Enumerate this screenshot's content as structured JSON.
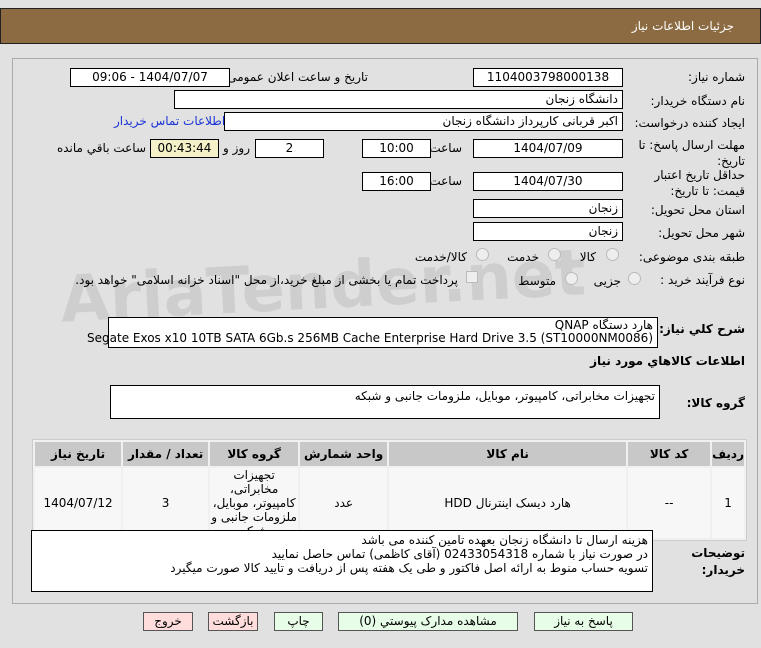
{
  "header": {
    "title": "جزئیات اطلاعات نیاز"
  },
  "watermark": "AriaTender.net",
  "form": {
    "need_number_label": "شماره نیاز:",
    "need_number": "1104003798000138",
    "announce_label": "تاریخ و ساعت اعلان عمومی:",
    "announce_value": "1404/07/07 - 09:06",
    "buyer_org_label": "نام دستگاه خریدار:",
    "buyer_org": "دانشگاه زنجان",
    "creator_label": "ایجاد کننده درخواست:",
    "creator": "اکبر قربانی کارپرداز دانشگاه زنجان",
    "contact_link": "اطلاعات تماس خریدار",
    "deadline_label": "مهلت ارسال پاسخ: تا تاریخ:",
    "deadline_date": "1404/07/09",
    "time_label": "ساعت",
    "deadline_time": "10:00",
    "days": "2",
    "days_label": "روز و",
    "remaining": "00:43:44",
    "remaining_label": "ساعت باقي مانده",
    "validity_label": "حداقل تاریخ اعتبار قیمت: تا تاریخ:",
    "validity_date": "1404/07/30",
    "validity_time": "16:00",
    "province_label": "استان محل تحویل:",
    "province": "زنجان",
    "city_label": "شهر محل تحویل:",
    "city": "زنجان",
    "category_label": "طبقه بندی موضوعی:",
    "category_options": [
      "کالا",
      "خدمت",
      "کالا/خدمت"
    ],
    "process_label": "نوع فرآیند خرید :",
    "process_options": [
      "جزیی",
      "متوسط"
    ],
    "payment_note": "پرداخت تمام یا بخشی از مبلغ خرید،از محل \"اسناد خزانه اسلامی\" خواهد بود.",
    "description_label": "شرح کلي نياز:",
    "description_line1": "هارد دستگاه QNAP",
    "description_line2": "Segate Exos x10 10TB SATA 6Gb.s 256MB Cache Enterprise Hard Drive 3.5 (ST10000NM0086)",
    "goods_info_title": "اطلاعات کالاهاي مورد نياز",
    "goods_group_label": "گروه کالا:",
    "goods_group": "تجهیزات مخابراتی، کامپیوتر، موبایل، ملزومات جانبی و شبکه"
  },
  "table": {
    "headers": [
      "ردیف",
      "کد کالا",
      "نام کالا",
      "واحد شمارش",
      "گروه کالا",
      "تعداد / مقدار",
      "تاریخ نیاز"
    ],
    "rows": [
      [
        "1",
        "--",
        "هارد دیسک اینترنال HDD",
        "عدد",
        "تجهیزات مخابراتی، کامپیوتر، موبایل، ملزومات جانبی و شبکه",
        "3",
        "1404/07/12"
      ]
    ]
  },
  "notes": {
    "label": "توضیحات خریدار:",
    "lines": [
      "هزینه ارسال تا دانشگاه زنجان بعهده تامین کننده می باشد",
      "در صورت نیاز با شماره 02433054318 (آقای کاظمی) تماس حاصل نمایید",
      "تسویه حساب منوط به ارائه اصل فاکتور و طی یک هفته پس از دریافت و تایید کالا صورت میگیرد"
    ]
  },
  "buttons": {
    "reply": "پاسخ به نیاز",
    "attachments": "مشاهده مدارک پیوستي (0)",
    "print": "چاپ",
    "back": "بازگشت",
    "exit": "خروج"
  }
}
